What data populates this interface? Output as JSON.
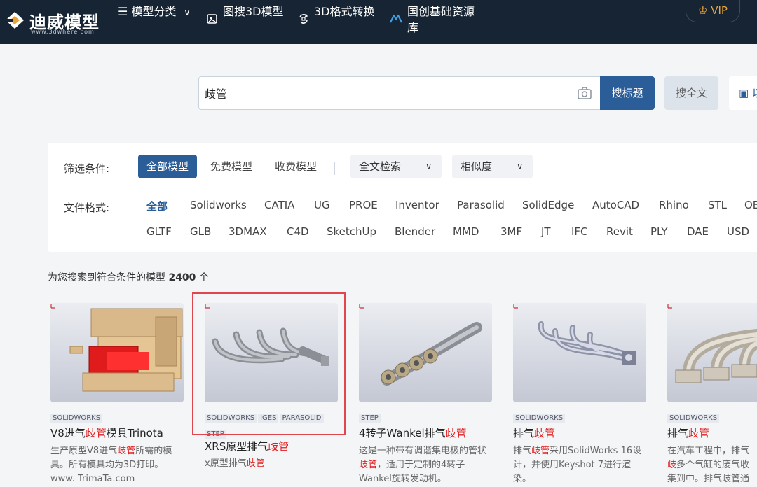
{
  "header": {
    "logo_text": "迪威模型",
    "logo_sub": "www.3dwhere.com",
    "nav": {
      "categories": "模型分类",
      "image_search": "图搜3D模型",
      "format_convert": "3D格式转换",
      "resource_lib": "国创基础资源库"
    },
    "vip": "VIP"
  },
  "search": {
    "value": "歧管",
    "btn_title": "搜标题",
    "btn_full": "搜全文",
    "btn_img": "以"
  },
  "filter": {
    "conditions_label": "筛选条件:",
    "chips": [
      "全部模型",
      "免费模型",
      "收费模型"
    ],
    "select_search": "全文检索",
    "select_sort": "相似度",
    "format_label": "文件格式:",
    "formats_row1": [
      "全部",
      "Solidworks",
      "CATIA",
      "UG",
      "PROE",
      "Inventor",
      "Parasolid",
      "SolidEdge",
      "AutoCAD",
      "Rhino",
      "STL",
      "OB"
    ],
    "formats_row2": [
      "GLTF",
      "GLB",
      "3DMAX",
      "C4D",
      "SketchUp",
      "Blender",
      "MMD",
      "3MF",
      "JT",
      "IFC",
      "Revit",
      "PLY",
      "DAE",
      "USD"
    ]
  },
  "results": {
    "prefix": "为您搜索到符合条件的模型",
    "count": "2400",
    "suffix": "个"
  },
  "cards": [
    {
      "tags": [
        "SOLIDWORKS"
      ],
      "title_pre": "V8进气",
      "title_hl": "歧管",
      "title_post": "模具Trinota",
      "desc_pre": "生产原型V8进气",
      "desc_hl": "歧管",
      "desc_post": "所需的模具。所有模具均为3D打印。www. TrimaTa.com"
    },
    {
      "tags": [
        "SOLIDWORKS",
        "IGES",
        "PARASOLID",
        "STEP"
      ],
      "title_pre": "XRS原型排气",
      "title_hl": "歧管",
      "title_post": "",
      "desc_pre": "x原型排气",
      "desc_hl": "歧管",
      "desc_post": ""
    },
    {
      "tags": [
        "STEP"
      ],
      "title_pre": "4转子Wankel排气",
      "title_hl": "歧管",
      "title_post": "",
      "desc_pre": "这是一种带有调谐集电极的管状",
      "desc_hl": "歧管",
      "desc_post": "，适用于定制的4转子Wankel旋转发动机。"
    },
    {
      "tags": [
        "SOLIDWORKS"
      ],
      "title_pre": "排气",
      "title_hl": "歧管",
      "title_post": "",
      "desc_pre": "排气",
      "desc_hl": "歧管",
      "desc_post": "采用SolidWorks 16设计，并使用Keyshot 7进行渲染。"
    },
    {
      "tags": [
        "SOLIDWORKS"
      ],
      "title_pre": "排气",
      "title_hl": "歧管",
      "title_post": "",
      "desc_pre": "在汽车工程中，排气",
      "desc_hl": "歧",
      "desc_post": "多个气缸的废气收集到中。排气歧管通常是简"
    }
  ],
  "colors": {
    "header_bg": "#172433",
    "accent": "#2b5d98",
    "highlight": "#e02020",
    "vip": "#e8a43c",
    "selection_box": "#e0464b"
  }
}
